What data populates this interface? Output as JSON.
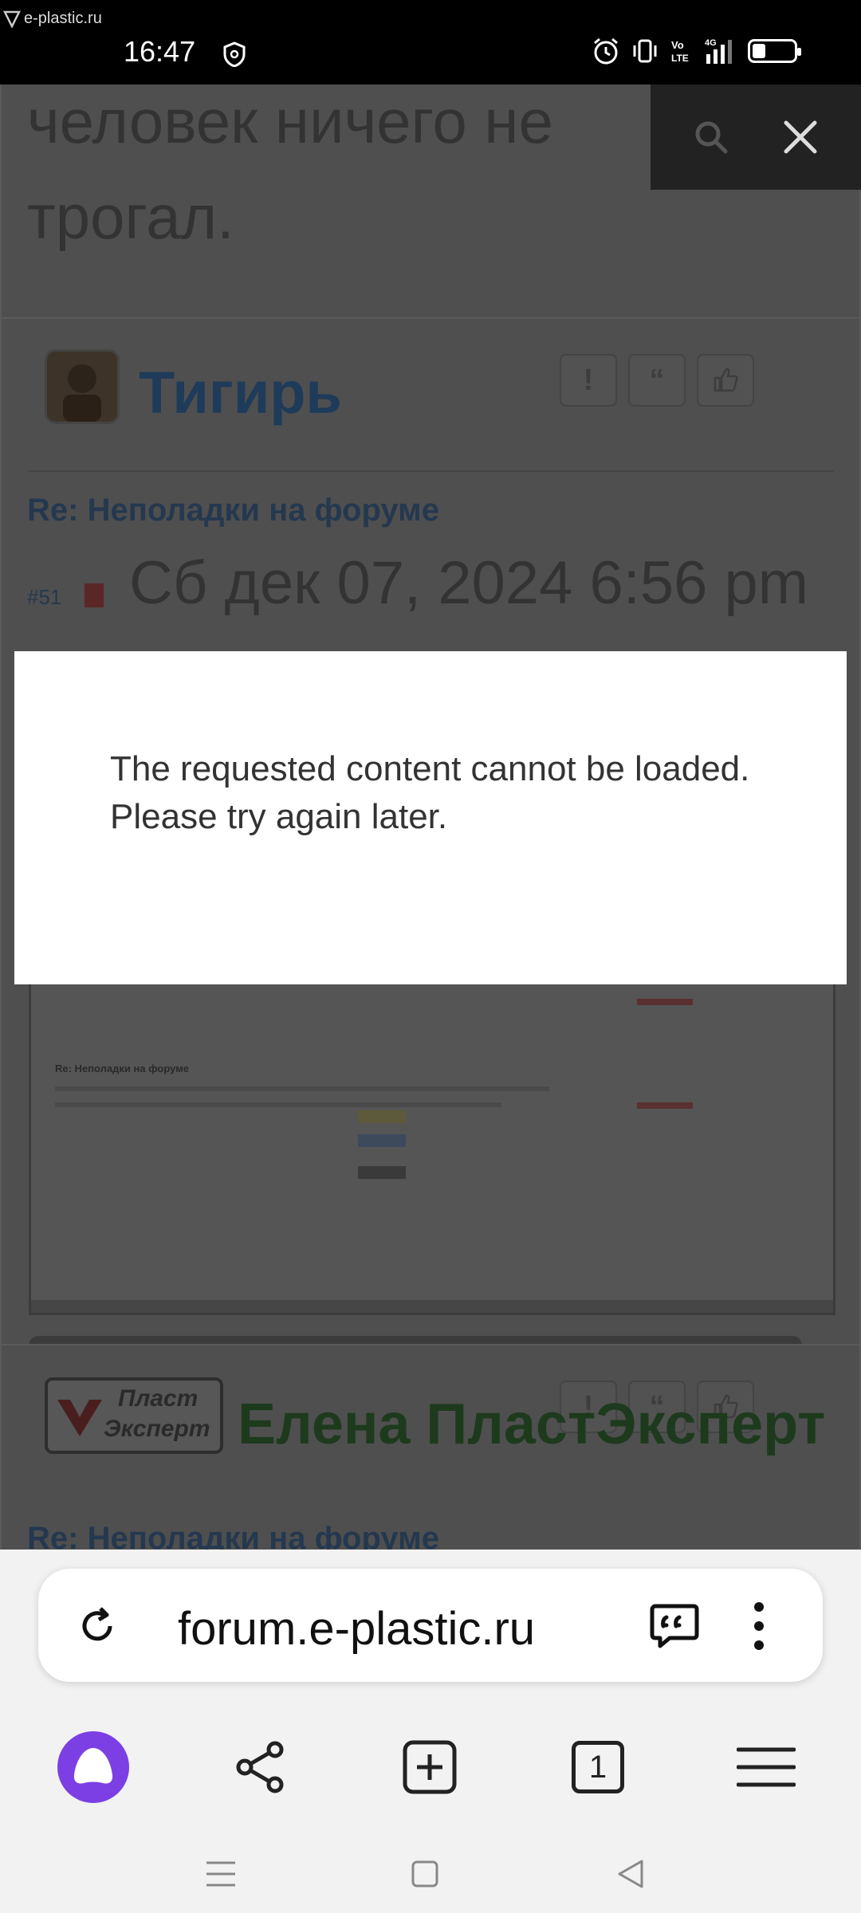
{
  "status_bar": {
    "site_label": "e-plastic.ru",
    "time": "16:47",
    "icons": [
      "shield-icon",
      "alarm-icon",
      "vibrate-icon",
      "volte-icon",
      "signal-4g-icon",
      "battery-icon"
    ],
    "network_label": "4G"
  },
  "page": {
    "prev_post_text_line1": "человек ничего не",
    "prev_post_text_line2": "трогал.",
    "post1": {
      "author": "Тигирь",
      "title": "Re: Неполадки на форуме",
      "number": "#51",
      "date": "Сб дек 07, 2024 6:56 pm",
      "author_color": "#1f3b5a"
    },
    "post2": {
      "author": "Елена ПластЭксперт",
      "title": "Re: Неполадки на форуме",
      "author_color": "#1d3a1d",
      "logo_line1": "Пласт",
      "logo_line2": "Эксперт"
    },
    "thumbnail": {
      "title": "Re: Неполадки на форуме"
    }
  },
  "modal": {
    "message_line1": "The requested content cannot be loaded.",
    "message_line2": "Please try again later."
  },
  "browser": {
    "url": "forum.e-plastic.ru",
    "tab_count": "1",
    "accent": "#7b3fe4"
  }
}
